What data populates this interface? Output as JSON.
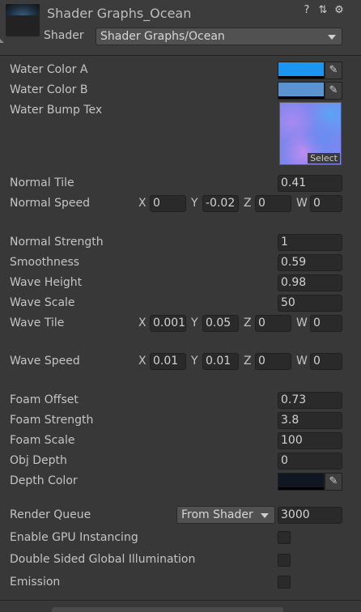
{
  "header": {
    "title": "Shader Graphs_Ocean",
    "shader_label": "Shader",
    "shader_value": "Shader Graphs/Ocean"
  },
  "icons": {
    "help": "help-icon",
    "presets": "presets-icon",
    "settings": "gear-icon",
    "picker": "eyedropper-icon"
  },
  "colors": {
    "water_a": "#1c95f0",
    "water_b": "#5a93cf",
    "depth": "#101722"
  },
  "props": {
    "water_color_a": "Water Color A",
    "water_color_b": "Water Color B",
    "water_bump_tex": "Water Bump Tex",
    "select": "Select",
    "normal_tile": {
      "label": "Normal Tile",
      "value": "0.41"
    },
    "normal_speed": {
      "label": "Normal Speed",
      "x": "0",
      "y": "-0.02",
      "z": "0",
      "w": "0"
    },
    "normal_strength": {
      "label": "Normal Strength",
      "value": "1"
    },
    "smoothness": {
      "label": "Smoothness",
      "value": "0.59"
    },
    "wave_height": {
      "label": "Wave Height",
      "value": "0.98"
    },
    "wave_scale": {
      "label": "Wave Scale",
      "value": "50"
    },
    "wave_tile": {
      "label": "Wave Tile",
      "x": "0.001",
      "y": "0.05",
      "z": "0",
      "w": "0"
    },
    "wave_speed": {
      "label": "Wave Speed",
      "x": "0.01",
      "y": "0.01",
      "z": "0",
      "w": "0"
    },
    "foam_offset": {
      "label": "Foam Offset",
      "value": "0.73"
    },
    "foam_strength": {
      "label": "Foam Strength",
      "value": "3.8"
    },
    "foam_scale": {
      "label": "Foam Scale",
      "value": "100"
    },
    "obj_depth": {
      "label": "Obj Depth",
      "value": "0"
    },
    "depth_color": "Depth Color"
  },
  "axes": {
    "x": "X",
    "y": "Y",
    "z": "Z",
    "w": "W"
  },
  "render": {
    "queue_label": "Render Queue",
    "queue_mode": "From Shader",
    "queue_value": "3000",
    "gpu_instancing": "Enable GPU Instancing",
    "double_sided_gi": "Double Sided Global Illumination",
    "emission": "Emission"
  }
}
